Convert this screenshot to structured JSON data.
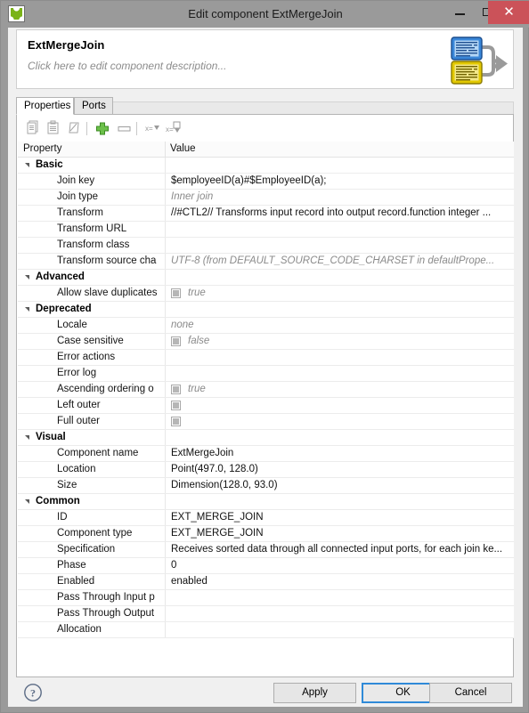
{
  "window": {
    "title": "Edit component ExtMergeJoin",
    "app_icon": "clover-app-icon",
    "minimize_label": "Minimize",
    "maximize_label": "Maximize",
    "close_label": "Close",
    "close_glyph": "✕",
    "close_color": "#cb5259"
  },
  "header": {
    "title": "ExtMergeJoin",
    "description": "Click here to edit component description...",
    "icon": "merge-join-component-icon"
  },
  "tabs": [
    {
      "label": "Properties",
      "active": true
    },
    {
      "label": "Ports",
      "active": false
    }
  ],
  "toolbar": {
    "items": [
      {
        "name": "copy-icon",
        "title": "Copy"
      },
      {
        "name": "paste-icon",
        "title": "Paste"
      },
      {
        "name": "edit-icon",
        "title": "Edit"
      },
      {
        "name": "add-icon",
        "title": "Add"
      },
      {
        "name": "remove-icon",
        "title": "Remove"
      },
      {
        "name": "collapse-all-icon",
        "title": "Collapse All"
      },
      {
        "name": "expand-all-icon",
        "title": "Expand All"
      }
    ]
  },
  "table": {
    "columns": [
      "Property",
      "Value"
    ],
    "rows": [
      {
        "type": "group",
        "property": "Basic",
        "value": ""
      },
      {
        "type": "leaf",
        "property": "Join key",
        "value": "$employeeID(a)#$EmployeeID(a);",
        "style": "normal"
      },
      {
        "type": "leaf",
        "property": "Join type",
        "value": "Inner join",
        "style": "muted"
      },
      {
        "type": "leaf",
        "property": "Transform",
        "value": "//#CTL2// Transforms input record into output record.function integer ...",
        "style": "normal"
      },
      {
        "type": "leaf",
        "property": "Transform URL",
        "value": "",
        "style": "normal"
      },
      {
        "type": "leaf",
        "property": "Transform class",
        "value": "",
        "style": "normal"
      },
      {
        "type": "leaf",
        "property": "Transform source cha",
        "value": "UTF-8 (from DEFAULT_SOURCE_CODE_CHARSET in defaultPrope...",
        "style": "muted"
      },
      {
        "type": "group",
        "property": "Advanced",
        "value": ""
      },
      {
        "type": "leaf",
        "property": "Allow slave duplicates",
        "value": "true",
        "style": "muted",
        "checkbox": true
      },
      {
        "type": "group",
        "property": "Deprecated",
        "value": ""
      },
      {
        "type": "leaf",
        "property": "Locale",
        "value": "none",
        "style": "muted"
      },
      {
        "type": "leaf",
        "property": "Case sensitive",
        "value": "false",
        "style": "muted",
        "checkbox": true
      },
      {
        "type": "leaf",
        "property": "Error actions",
        "value": "",
        "style": "normal"
      },
      {
        "type": "leaf",
        "property": "Error log",
        "value": "",
        "style": "normal"
      },
      {
        "type": "leaf",
        "property": "Ascending ordering o",
        "value": "true",
        "style": "muted",
        "checkbox": true
      },
      {
        "type": "leaf",
        "property": "Left outer",
        "value": "",
        "style": "normal",
        "checkbox": true
      },
      {
        "type": "leaf",
        "property": "Full outer",
        "value": "",
        "style": "normal",
        "checkbox": true
      },
      {
        "type": "group",
        "property": "Visual",
        "value": ""
      },
      {
        "type": "leaf",
        "property": "Component name",
        "value": "ExtMergeJoin",
        "style": "normal"
      },
      {
        "type": "leaf",
        "property": "Location",
        "value": "Point(497.0, 128.0)",
        "style": "normal"
      },
      {
        "type": "leaf",
        "property": "Size",
        "value": "Dimension(128.0, 93.0)",
        "style": "normal"
      },
      {
        "type": "group",
        "property": "Common",
        "value": ""
      },
      {
        "type": "leaf",
        "property": "ID",
        "value": "EXT_MERGE_JOIN",
        "style": "normal"
      },
      {
        "type": "leaf",
        "property": "Component type",
        "value": "EXT_MERGE_JOIN",
        "style": "normal"
      },
      {
        "type": "leaf",
        "property": "Specification",
        "value": "Receives sorted data through all connected input ports, for each join ke...",
        "style": "normal"
      },
      {
        "type": "leaf",
        "property": "Phase",
        "value": "0",
        "style": "normal"
      },
      {
        "type": "leaf",
        "property": "Enabled",
        "value": "enabled",
        "style": "normal"
      },
      {
        "type": "leaf",
        "property": "Pass Through Input p",
        "value": "",
        "style": "normal"
      },
      {
        "type": "leaf",
        "property": "Pass Through Output",
        "value": "",
        "style": "normal"
      },
      {
        "type": "leaf",
        "property": "Allocation",
        "value": "",
        "style": "normal"
      }
    ]
  },
  "footer": {
    "help_icon": "help-question-icon",
    "apply_label": "Apply",
    "ok_label": "OK",
    "cancel_label": "Cancel",
    "focus_color": "#2f8ad8"
  }
}
